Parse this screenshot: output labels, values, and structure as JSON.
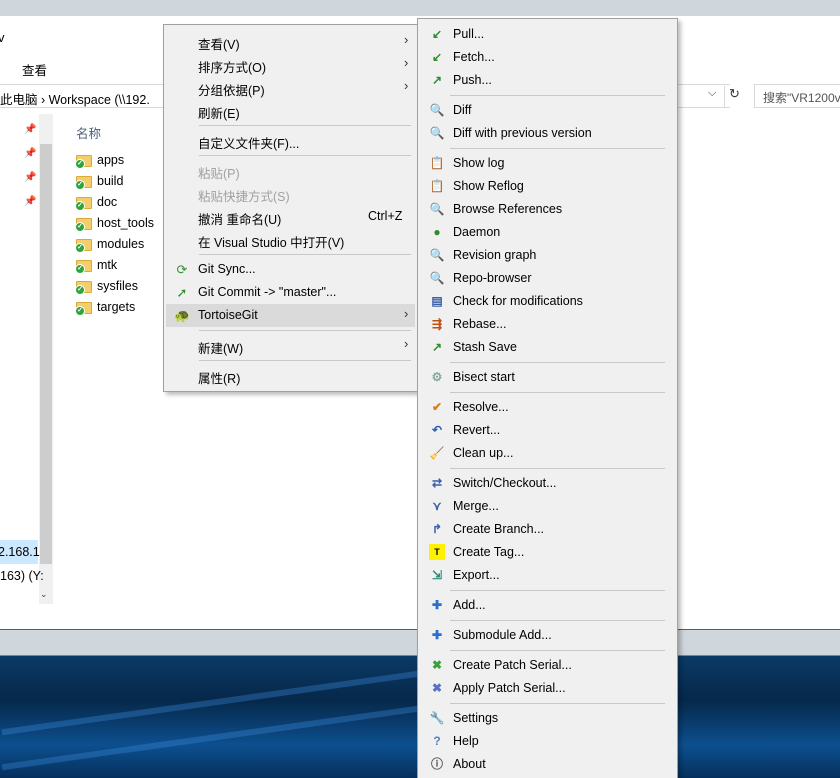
{
  "explorer": {
    "title_fragment": "v",
    "ribbon_tab": "查看",
    "address_path": "此电脑  ›  Workspace (\\\\192.",
    "search_placeholder": "搜索\"VR1200v",
    "column_header": "名称",
    "nav_ip_selected": "2.168.1",
    "nav_ip_second": "163) (Y:",
    "files": [
      "apps",
      "build",
      "doc",
      "host_tools",
      "modules",
      "mtk",
      "sysfiles",
      "targets"
    ]
  },
  "menu1": {
    "items": [
      {
        "label": "查看(V)",
        "arrow": "›"
      },
      {
        "label": "排序方式(O)",
        "arrow": "›"
      },
      {
        "label": "分组依据(P)",
        "arrow": "›"
      },
      {
        "label": "刷新(E)"
      },
      {
        "label": "自定义文件夹(F)..."
      },
      {
        "label": "粘贴(P)"
      },
      {
        "label": "粘贴快捷方式(S)"
      },
      {
        "label": "撤消 重命名(U)",
        "shortcut": "Ctrl+Z"
      },
      {
        "label": "在 Visual Studio 中打开(V)"
      },
      {
        "label": "Git Sync..."
      },
      {
        "label": "Git Commit -> \"master\"..."
      },
      {
        "label": "TortoiseGit",
        "arrow": "›"
      },
      {
        "label": "新建(W)",
        "arrow": "›"
      },
      {
        "label": "属性(R)"
      }
    ]
  },
  "menu2": {
    "items": [
      {
        "label": "Pull...",
        "icon": "pull-icon"
      },
      {
        "label": "Fetch...",
        "icon": "fetch-icon"
      },
      {
        "label": "Push...",
        "icon": "push-icon"
      },
      {
        "label": "Diff",
        "icon": "diff-icon"
      },
      {
        "label": "Diff with previous version",
        "icon": "diff-previous-icon"
      },
      {
        "label": "Show log",
        "icon": "show-log-icon"
      },
      {
        "label": "Show Reflog",
        "icon": "reflog-icon"
      },
      {
        "label": "Browse References",
        "icon": "browse-references-icon"
      },
      {
        "label": "Daemon",
        "icon": "daemon-icon"
      },
      {
        "label": "Revision graph",
        "icon": "revision-graph-icon"
      },
      {
        "label": "Repo-browser",
        "icon": "repo-browser-icon"
      },
      {
        "label": "Check for modifications",
        "icon": "check-modifications-icon"
      },
      {
        "label": "Rebase...",
        "icon": "rebase-icon"
      },
      {
        "label": "Stash Save",
        "icon": "stash-icon"
      },
      {
        "label": "Bisect start",
        "icon": "bisect-icon"
      },
      {
        "label": "Resolve...",
        "icon": "resolve-icon"
      },
      {
        "label": "Revert...",
        "icon": "revert-icon"
      },
      {
        "label": "Clean up...",
        "icon": "cleanup-icon"
      },
      {
        "label": "Switch/Checkout...",
        "icon": "switch-icon"
      },
      {
        "label": "Merge...",
        "icon": "merge-icon"
      },
      {
        "label": "Create Branch...",
        "icon": "branch-icon"
      },
      {
        "label": "Create Tag...",
        "icon": "tag-icon"
      },
      {
        "label": "Export...",
        "icon": "export-icon"
      },
      {
        "label": "Add...",
        "icon": "add-icon"
      },
      {
        "label": "Submodule Add...",
        "icon": "submodule-add-icon"
      },
      {
        "label": "Create Patch Serial...",
        "icon": "create-patch-icon"
      },
      {
        "label": "Apply Patch Serial...",
        "icon": "apply-patch-icon"
      },
      {
        "label": "Settings",
        "icon": "settings-icon"
      },
      {
        "label": "Help",
        "icon": "help-icon"
      },
      {
        "label": "About",
        "icon": "about-icon"
      }
    ]
  }
}
